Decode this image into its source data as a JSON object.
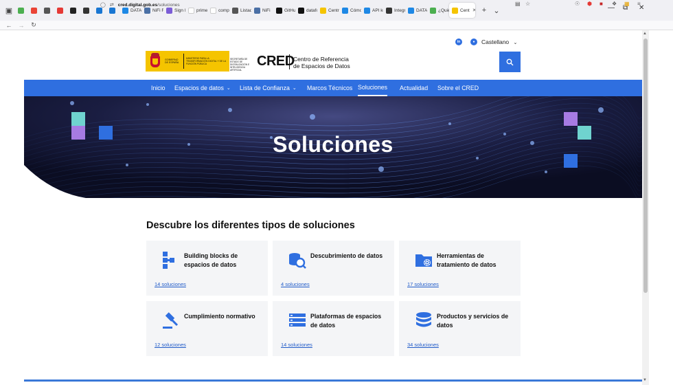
{
  "browser": {
    "tabs": [
      {
        "label": "",
        "color": "#4caf50"
      },
      {
        "label": "",
        "color": "#ea4335"
      },
      {
        "label": "",
        "color": "#555555"
      },
      {
        "label": "",
        "color": "#e53935"
      },
      {
        "label": "",
        "color": "#222222"
      },
      {
        "label": "",
        "color": "#333333"
      },
      {
        "label": "",
        "color": "#1976d2"
      },
      {
        "label": "",
        "color": "#1976d2"
      },
      {
        "label": "DATAF",
        "color": "#1e88e5"
      },
      {
        "label": "NiFi Fl",
        "color": "#4a6fa5"
      },
      {
        "label": "Sign In",
        "color": "#7b5cd6"
      },
      {
        "label": "primer",
        "color": "#ffffff"
      },
      {
        "label": "compo",
        "color": "#ffffff"
      },
      {
        "label": "Listad",
        "color": "#555555"
      },
      {
        "label": "NiFi",
        "color": "#4a6fa5"
      },
      {
        "label": "GitHub",
        "color": "#111111"
      },
      {
        "label": "datafo",
        "color": "#111111"
      },
      {
        "label": "Centro",
        "color": "#f5c400"
      },
      {
        "label": "Cómo",
        "color": "#1e88e5"
      },
      {
        "label": "API key",
        "color": "#1e88e5"
      },
      {
        "label": "Integra",
        "color": "#333333"
      },
      {
        "label": "DATAF",
        "color": "#1e88e5"
      },
      {
        "label": "¿Quién",
        "color": "#4caf50"
      },
      {
        "label": "Cent",
        "color": "#f5c400",
        "active": true
      }
    ],
    "url_domain": "cred.digital.gob.es",
    "url_path": "/soluciones"
  },
  "header": {
    "language": "Castellano",
    "gov_line1": "Gobierno de España",
    "gov_line2": "Ministerio para la Transformación Digital y de la Función Pública",
    "secretaria": "Secretaría de Estado de Digitalización e Inteligencia Artificial",
    "brand": "CRED",
    "brand_sub_1": "Centro de Referencia",
    "brand_sub_2": "de Espacios de Datos",
    "accent_color": "#2f6fe0"
  },
  "nav": {
    "items": [
      {
        "label": "Inicio"
      },
      {
        "label": "Espacios de datos",
        "dropdown": true
      },
      {
        "label": "Lista de Confianza",
        "dropdown": true
      },
      {
        "label": "Marcos Técnicos"
      },
      {
        "label": "Soluciones",
        "active": true
      },
      {
        "label": "Actualidad"
      },
      {
        "label": "Sobre el CRED"
      }
    ]
  },
  "hero": {
    "title": "Soluciones"
  },
  "main": {
    "section_title": "Descubre los diferentes tipos de soluciones",
    "cards": [
      {
        "title": "Building blocks de espacios de datos",
        "link": "14 soluciones",
        "icon": "building-blocks-icon"
      },
      {
        "title": "Descubrimiento de datos",
        "link": "4 soluciones",
        "icon": "data-discovery-icon"
      },
      {
        "title": "Herramientas de tratamiento de datos",
        "link": "17 soluciones",
        "icon": "folder-gear-icon"
      },
      {
        "title": "Cumplimiento normativo",
        "link": "12 soluciones",
        "icon": "gavel-icon"
      },
      {
        "title": "Plataformas de espacios de datos",
        "link": "14 soluciones",
        "icon": "server-icon"
      },
      {
        "title": "Productos y servicios de datos",
        "link": "34 soluciones",
        "icon": "database-icon"
      }
    ]
  }
}
